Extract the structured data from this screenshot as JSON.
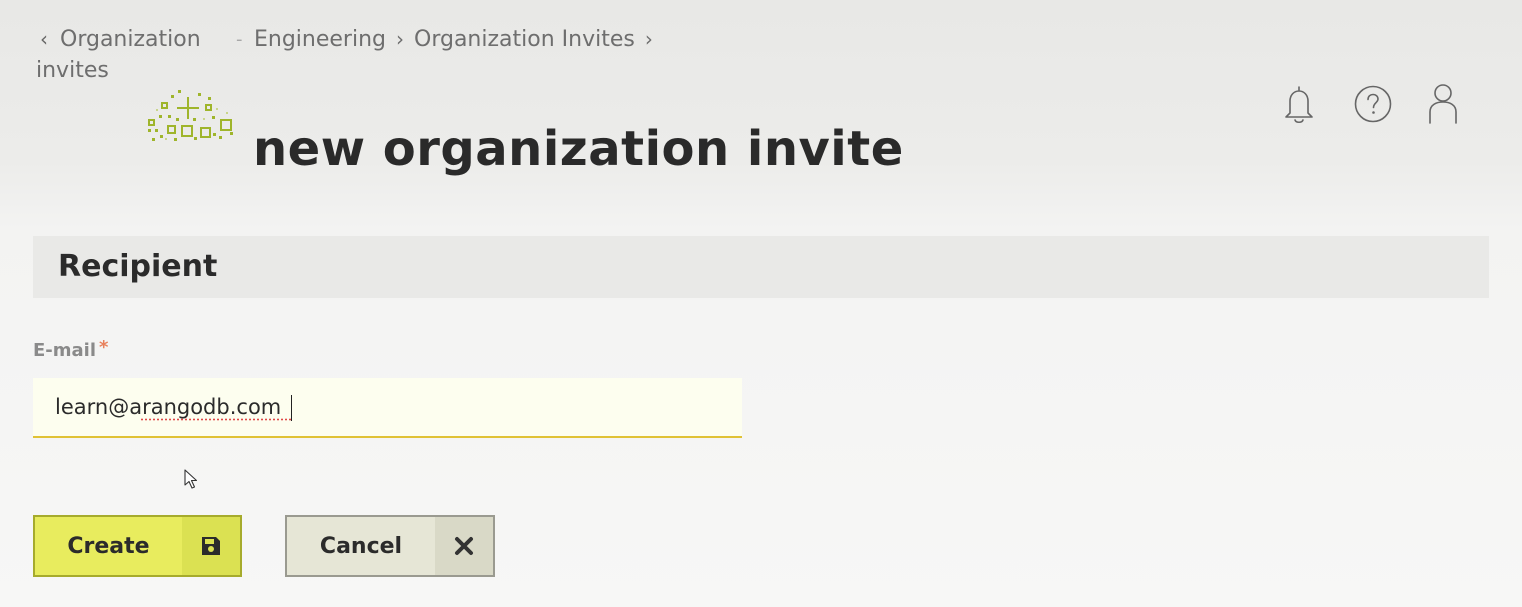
{
  "breadcrumb": {
    "back_line1": "Organization",
    "back_line2": "invites",
    "separator": "-",
    "items": [
      "Engineering",
      "Organization Invites"
    ]
  },
  "header": {
    "title": "new organization invite",
    "icons": [
      "bell-icon",
      "help-icon",
      "user-icon"
    ]
  },
  "section": {
    "title": "Recipient"
  },
  "form": {
    "email_label": "E-mail",
    "required_marker": "*",
    "email_value": "learn@arangodb.com"
  },
  "buttons": {
    "create_label": "Create",
    "cancel_label": "Cancel"
  },
  "colors": {
    "accent_green": "#e8ec5e",
    "logo_green": "#9fb52b",
    "required": "#e8815c",
    "input_underline": "#e0c235"
  }
}
